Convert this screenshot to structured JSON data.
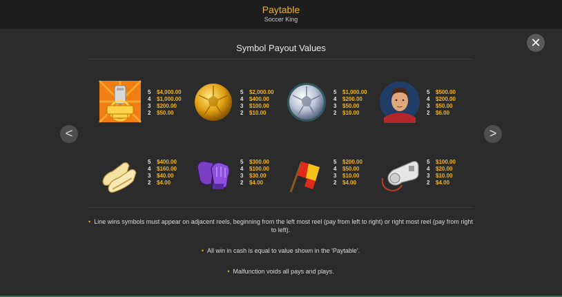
{
  "header": {
    "title": "Paytable",
    "subtitle": "Soccer King"
  },
  "close_label": "✕",
  "section_title": "Symbol Payout Values",
  "nav": {
    "prev_label": "<",
    "next_label": ">"
  },
  "symbols": [
    {
      "name": "king-trophy",
      "payouts": [
        {
          "count": "5",
          "amount": "$4,000.00"
        },
        {
          "count": "4",
          "amount": "$1,000.00"
        },
        {
          "count": "3",
          "amount": "$200.00"
        },
        {
          "count": "2",
          "amount": "$50.00"
        }
      ]
    },
    {
      "name": "gold-ball",
      "payouts": [
        {
          "count": "5",
          "amount": "$2,000.00"
        },
        {
          "count": "4",
          "amount": "$400.00"
        },
        {
          "count": "3",
          "amount": "$100.00"
        },
        {
          "count": "2",
          "amount": "$10.00"
        }
      ]
    },
    {
      "name": "silver-ball",
      "payouts": [
        {
          "count": "5",
          "amount": "$1,000.00"
        },
        {
          "count": "4",
          "amount": "$200.00"
        },
        {
          "count": "3",
          "amount": "$50.00"
        },
        {
          "count": "2",
          "amount": "$10.00"
        }
      ]
    },
    {
      "name": "player",
      "payouts": [
        {
          "count": "5",
          "amount": "$500.00"
        },
        {
          "count": "4",
          "amount": "$200.00"
        },
        {
          "count": "3",
          "amount": "$50.00"
        },
        {
          "count": "2",
          "amount": "$6.00"
        }
      ]
    },
    {
      "name": "boots",
      "payouts": [
        {
          "count": "5",
          "amount": "$400.00"
        },
        {
          "count": "4",
          "amount": "$160.00"
        },
        {
          "count": "3",
          "amount": "$40.00"
        },
        {
          "count": "2",
          "amount": "$4.00"
        }
      ]
    },
    {
      "name": "gloves",
      "payouts": [
        {
          "count": "5",
          "amount": "$300.00"
        },
        {
          "count": "4",
          "amount": "$100.00"
        },
        {
          "count": "3",
          "amount": "$30.00"
        },
        {
          "count": "2",
          "amount": "$4.00"
        }
      ]
    },
    {
      "name": "flag",
      "payouts": [
        {
          "count": "5",
          "amount": "$200.00"
        },
        {
          "count": "4",
          "amount": "$50.00"
        },
        {
          "count": "3",
          "amount": "$10.00"
        },
        {
          "count": "2",
          "amount": "$4.00"
        }
      ]
    },
    {
      "name": "whistle",
      "payouts": [
        {
          "count": "5",
          "amount": "$100.00"
        },
        {
          "count": "4",
          "amount": "$20.00"
        },
        {
          "count": "3",
          "amount": "$10.00"
        },
        {
          "count": "2",
          "amount": "$4.00"
        }
      ]
    }
  ],
  "rules": [
    {
      "bullet": "•",
      "text": "Line wins symbols must appear on adjacent reels, beginning from the left most reel (pay from left to right) or right most reel (pay from right to left)."
    },
    {
      "bullet": "•",
      "text": "All win in cash is equal to value shown in the 'Paytable'."
    },
    {
      "bullet": "•",
      "text": "Malfunction voids all pays and plays."
    }
  ],
  "colors": {
    "accent": "#f2b41b",
    "background": "#2b2b2b",
    "header_bg": "#1d1d1d"
  }
}
